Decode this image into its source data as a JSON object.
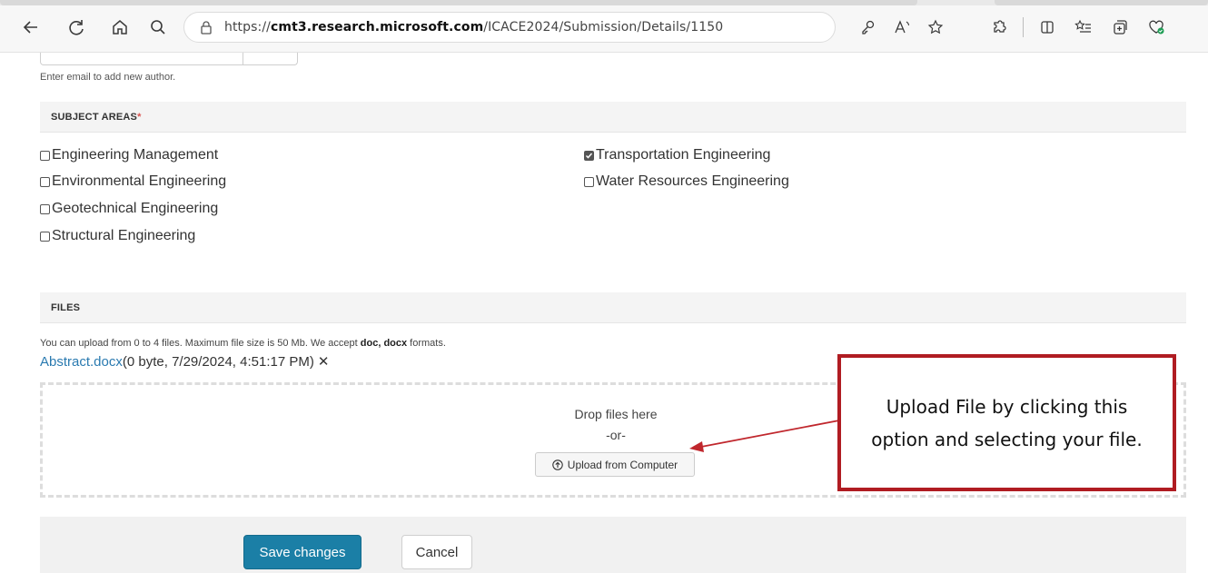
{
  "browser": {
    "url_prefix": "https://",
    "url_host": "cmt3.research.microsoft.com",
    "url_path": "/ICACE2024/Submission/Details/1150"
  },
  "authors": {
    "hint": "Enter email to add new author."
  },
  "subject_areas": {
    "title": "SUBJECT AREAS",
    "required_mark": "*",
    "items": [
      {
        "label": "Engineering Management",
        "checked": false
      },
      {
        "label": "Environmental Engineering",
        "checked": false
      },
      {
        "label": "Geotechnical Engineering",
        "checked": false
      },
      {
        "label": "Structural Engineering",
        "checked": false
      },
      {
        "label": "Transportation Engineering",
        "checked": true
      },
      {
        "label": "Water Resources Engineering",
        "checked": false
      }
    ]
  },
  "files": {
    "title": "FILES",
    "note_prefix": "You can upload from 0 to 4 files. Maximum file size is 50 Mb. We accept ",
    "note_formats": "doc, docx",
    "note_suffix": " formats.",
    "file_name": "Abstract.docx",
    "file_meta": " (0 byte, 7/29/2024, 4:51:17 PM)",
    "remove_glyph": "✕",
    "drop_text": "Drop files here",
    "or_text": "-or-",
    "upload_label": "Upload from Computer"
  },
  "actions": {
    "save_label": "Save changes",
    "cancel_label": "Cancel"
  },
  "callout": {
    "text": "Upload File by clicking this option and selecting your file."
  },
  "colors": {
    "accent": "#1b7fa6",
    "link": "#2a7ab0",
    "callout_border": "#b01c22"
  }
}
